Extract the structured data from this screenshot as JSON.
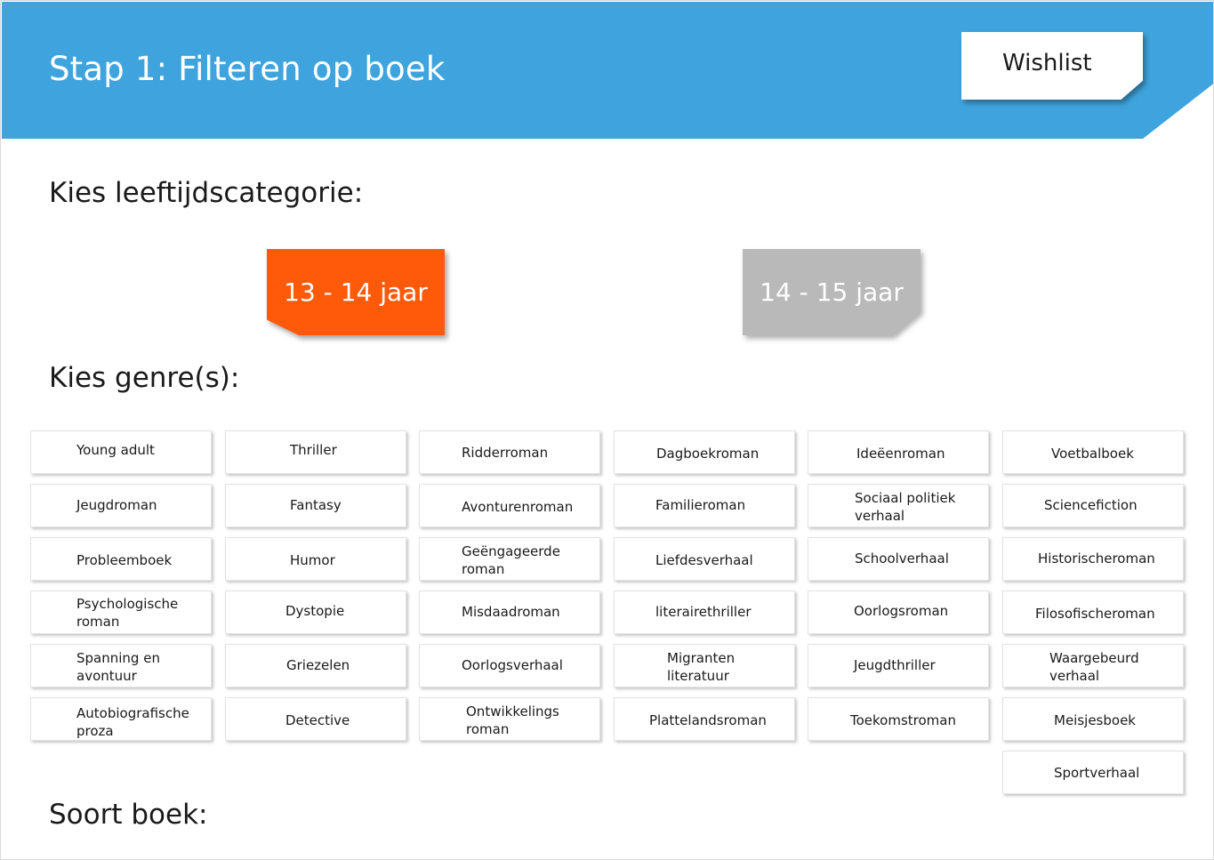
{
  "header": {
    "title": "Stap 1: Filteren op boek",
    "wishlist_label": "Wishlist"
  },
  "colors": {
    "header_bg": "#3fa4dd",
    "age_active": "#ff5a0a",
    "age_inactive": "#b9b9b9"
  },
  "age": {
    "title": "Kies leeftijdscategorie:",
    "options": [
      "13 - 14 jaar",
      "14 - 15 jaar"
    ],
    "selected": "13 - 14 jaar"
  },
  "genre": {
    "title": "Kies genre(s):",
    "columns": [
      [
        "Young adult",
        "Jeugdroman",
        "Probleemboek",
        "Psychologische roman",
        "Spanning en avontuur",
        "Autobiografische proza"
      ],
      [
        "Thriller",
        "Fantasy",
        "Humor",
        "Dystopie",
        "Griezelen",
        "Detective"
      ],
      [
        "Ridderroman",
        "Avonturenroman",
        "Geëngageerde roman",
        "Misdaadroman",
        "Oorlogsverhaal",
        "Ontwikkelings roman"
      ],
      [
        "Dagboekroman",
        "Familieroman",
        "Liefdesverhaal",
        "literairethriller",
        "Migranten literatuur",
        "Plattelandsroman"
      ],
      [
        "Ideëenroman",
        "Sociaal politiek verhaal",
        "Schoolverhaal",
        "Oorlogsroman",
        "Jeugdthriller",
        "Toekomstroman"
      ],
      [
        "Voetbalboek",
        "Sciencefiction",
        "Historischeroman",
        "Filosofischeroman",
        "Waargebeurd verhaal",
        "Meisjesboek",
        "Sportverhaal"
      ]
    ]
  },
  "book_type": {
    "title": "Soort boek:"
  }
}
